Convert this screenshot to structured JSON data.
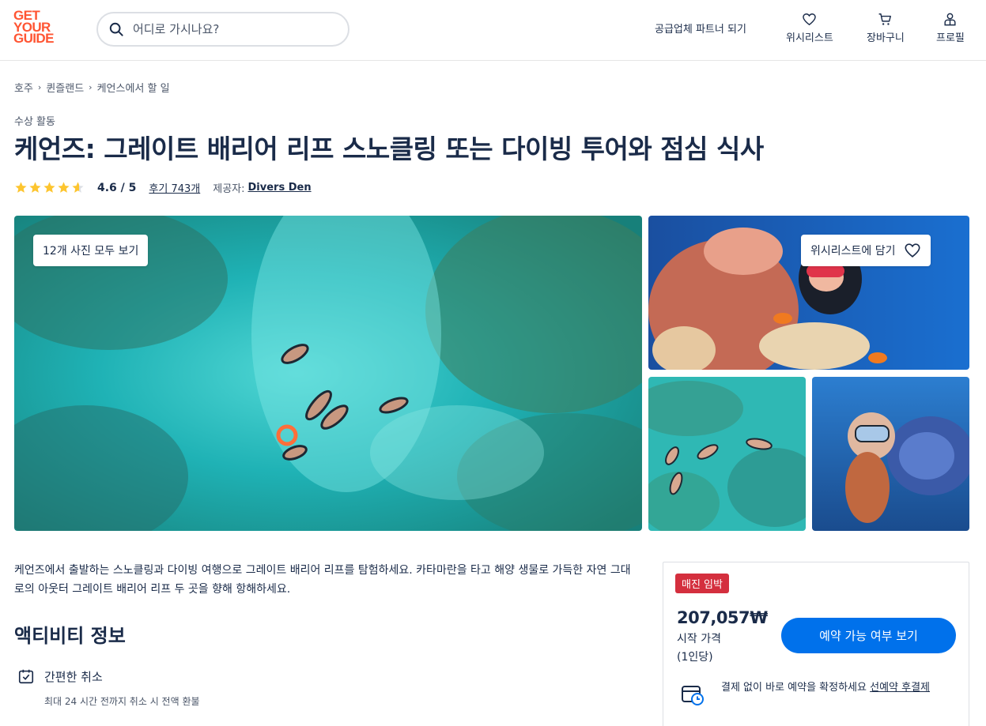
{
  "header": {
    "logo_lines": [
      "GET",
      "YOUR",
      "GUIDE"
    ],
    "search_placeholder": "어디로 가시나요?",
    "partner_link": "공급업체 파트너 되기",
    "nav": {
      "wishlist": "위시리스트",
      "cart": "장바구니",
      "profile": "프로필"
    }
  },
  "breadcrumb": [
    "호주",
    "퀸즐랜드",
    "케언스에서 할 일"
  ],
  "category": "수상 활동",
  "title": "케언즈: 그레이트 배리어 리프 스노클링 또는 다이빙 투어와 점심 식사",
  "rating": {
    "stars": 4.6,
    "value_text": "4.6 / 5",
    "reviews_text": "후기 743개",
    "provider_label": "제공자:",
    "provider": "Divers Den"
  },
  "gallery": {
    "all_photos_button": "12개 사진 모두 보기",
    "wishlist_button": "위시리스트에 담기"
  },
  "description": "케언즈에서 출발하는 스노클링과 다이빙 여행으로 그레이트 배리어 리프를 탐험하세요. 카타마란을 타고 해양 생물로 가득한 자연 그대로의 아웃터 그레이트 배리어 리프 두 곳을 향해 항해하세요.",
  "activity_info": {
    "heading": "액티비티 정보",
    "feature_title": "간편한 취소",
    "feature_sub": "최대 24 시간 전까지 취소 시 전액 환불"
  },
  "booking": {
    "badge": "매진 임박",
    "price": "207,057₩",
    "price_from": "시작 가격",
    "price_per": "(1인당)",
    "cta": "예약 가능 여부 보기",
    "pay_text": "결제 없이 바로 예약을 확정하세요 ",
    "pay_link": "선예약 후결제"
  },
  "colors": {
    "brand": "#ff5533",
    "primary": "#0071eb",
    "badge": "#d42f3e",
    "star": "#fdc52f",
    "text": "#1a2b49"
  }
}
